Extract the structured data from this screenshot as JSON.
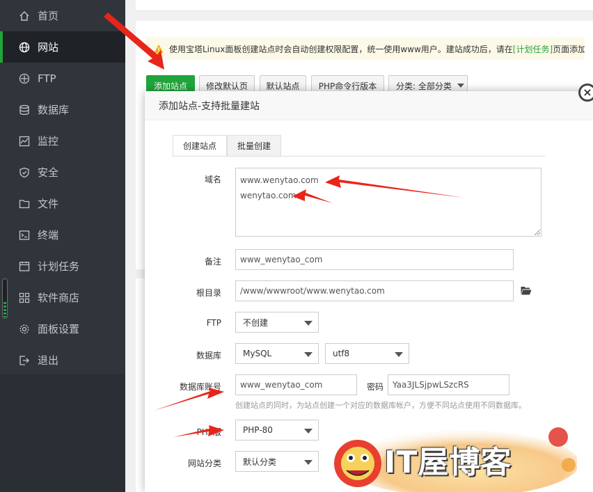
{
  "sidebar": {
    "items": [
      {
        "label": "首页",
        "icon": "home-icon"
      },
      {
        "label": "网站",
        "icon": "globe-icon",
        "active": true
      },
      {
        "label": "FTP",
        "icon": "ftp-icon"
      },
      {
        "label": "数据库",
        "icon": "database-icon"
      },
      {
        "label": "监控",
        "icon": "monitor-icon"
      },
      {
        "label": "安全",
        "icon": "shield-icon"
      },
      {
        "label": "文件",
        "icon": "folder-icon"
      },
      {
        "label": "终端",
        "icon": "terminal-icon"
      },
      {
        "label": "计划任务",
        "icon": "clock-icon"
      },
      {
        "label": "软件商店",
        "icon": "grid-icon"
      },
      {
        "label": "面板设置",
        "icon": "gear-icon"
      },
      {
        "label": "退出",
        "icon": "exit-icon"
      }
    ]
  },
  "notice": {
    "text_before": "使用宝塔Linux面板创建站点时会自动创建权限配置，统一使用www用户。建站成功后，请在",
    "link": "[计划任务]",
    "text_after": "页面添加定"
  },
  "toolbar": {
    "add_site": "添加站点",
    "modify_default_page": "修改默认页",
    "default_site": "默认站点",
    "php_cli_version": "PHP命令行版本",
    "category": "分类: 全部分类"
  },
  "modal": {
    "title": "添加站点-支持批量建站",
    "close": "×",
    "tabs": [
      "创建站点",
      "批量创建"
    ],
    "fields": {
      "domain_label": "域名",
      "domain_lines": [
        "www.wenytao.com",
        "wenytao.com"
      ],
      "remark_label": "备注",
      "remark_value": "www_wenytao_com",
      "root_label": "根目录",
      "root_value": "/www/wwwroot/www.wenytao.com",
      "ftp_label": "FTP",
      "ftp_value": "不创建",
      "db_label": "数据库",
      "db_type": "MySQL",
      "db_charset": "utf8",
      "db_account_label": "数据库账号",
      "db_account_value": "www_wenytao_com",
      "password_label": "密码",
      "password_value": "Yaa3JLSjpwLSzcRS",
      "db_hint": "创建站点的同时，为站点创建一个对应的数据库帐户，方便不同站点使用不同数据库。",
      "php_label": "PHP版",
      "php_value": "PHP-80",
      "category_label": "网站分类",
      "category_value": "默认分类"
    }
  },
  "watermark": {
    "text": "IT屋博客"
  },
  "colors": {
    "accent": "#20a53a",
    "sidebar_bg": "#30353b",
    "annotation": "#e8251a"
  }
}
